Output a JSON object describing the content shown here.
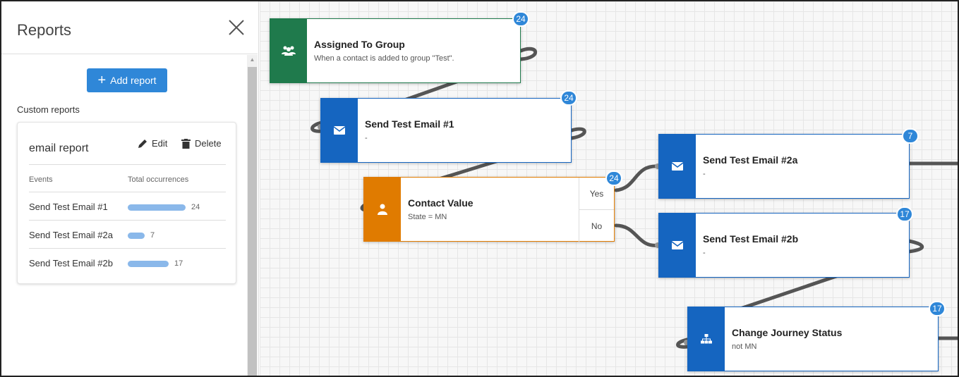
{
  "sidebar": {
    "title": "Reports",
    "add_report_label": "Add report",
    "custom_reports_label": "Custom reports",
    "report": {
      "name": "email report",
      "edit_label": "Edit",
      "delete_label": "Delete",
      "col_events": "Events",
      "col_total": "Total occurrences",
      "rows": [
        {
          "label": "Send Test Email #1",
          "value": "24",
          "fraction": 1.0
        },
        {
          "label": "Send Test Email #2a",
          "value": "7",
          "fraction": 0.29
        },
        {
          "label": "Send Test Email #2b",
          "value": "17",
          "fraction": 0.71
        }
      ]
    }
  },
  "canvas": {
    "nodes": [
      {
        "title": "Assigned To Group",
        "subtitle": "When a contact is added to group \"Test\".",
        "count": "24",
        "icon": "group-icon",
        "color": "#1f7a4c"
      },
      {
        "title": "Send Test Email #1",
        "subtitle": "-",
        "count": "24",
        "icon": "envelope-icon",
        "color": "#1565c0"
      },
      {
        "title": "Contact Value",
        "subtitle": "State = MN",
        "count": "24",
        "icon": "person-icon",
        "color": "#e07b00",
        "branches": [
          "Yes",
          "No"
        ]
      },
      {
        "title": "Send Test Email #2a",
        "subtitle": "-",
        "count": "7",
        "icon": "envelope-icon",
        "color": "#1565c0"
      },
      {
        "title": "Send Test Email #2b",
        "subtitle": "-",
        "count": "17",
        "icon": "envelope-icon",
        "color": "#1565c0"
      },
      {
        "title": "Change Journey Status",
        "subtitle": "not MN",
        "count": "17",
        "icon": "hierarchy-icon",
        "color": "#1565c0"
      }
    ]
  }
}
